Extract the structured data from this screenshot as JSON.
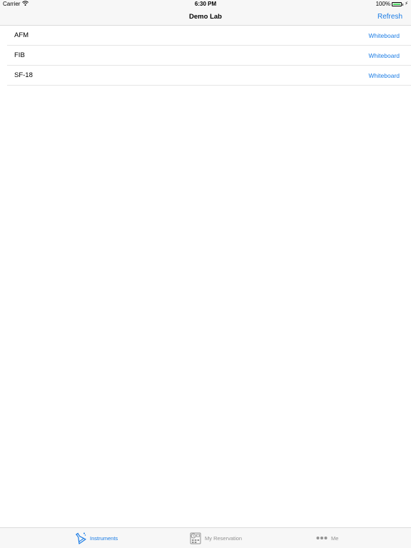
{
  "status_bar": {
    "carrier": "Carrier",
    "time": "6:30 PM",
    "battery": "100%",
    "battery_color": "#4cd964"
  },
  "nav": {
    "title": "Demo Lab",
    "refresh_label": "Refresh"
  },
  "instruments": [
    {
      "name": "AFM",
      "action": "Whiteboard"
    },
    {
      "name": "FIB",
      "action": "Whiteboard"
    },
    {
      "name": "SF-18",
      "action": "Whiteboard"
    }
  ],
  "tabs": [
    {
      "label": "Instruments",
      "icon": "flask-icon",
      "active": true
    },
    {
      "label": "My Reservation",
      "icon": "calendar-icon",
      "active": false
    },
    {
      "label": "Me",
      "icon": "more-dots-icon",
      "active": false
    }
  ],
  "colors": {
    "accent": "#1a7ce5",
    "inactive": "#929292"
  }
}
